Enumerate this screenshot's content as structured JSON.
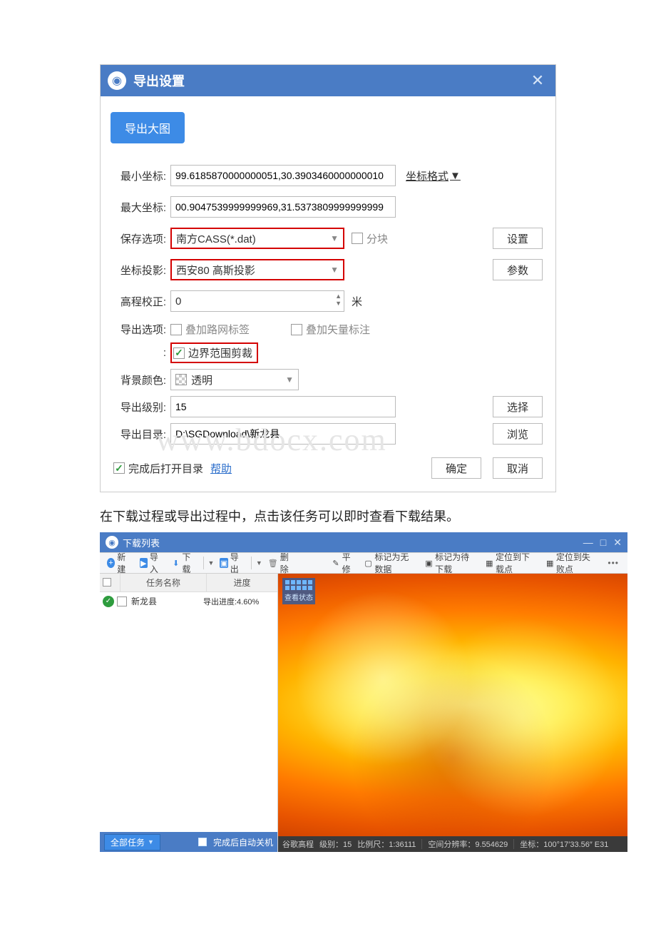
{
  "dialog": {
    "title": "导出设置",
    "tab": "导出大图",
    "labels": {
      "min_coord": "最小坐标",
      "max_coord": "最大坐标",
      "save_opt": "保存选项",
      "proj": "坐标投影",
      "elev": "高程校正",
      "export_opt": "导出选项",
      "bgcolor": "背景颜色",
      "level": "导出级别",
      "outdir": "导出目录"
    },
    "min_coord": "99.6185870000000051,30.3903460000000010",
    "max_coord": "00.9047539999999969,31.5373809999999999",
    "coord_format": "坐标格式",
    "save_option": "南方CASS(*.dat)",
    "split": "分块",
    "settings_btn": "设置",
    "projection": "西安80 高斯投影",
    "params_btn": "参数",
    "elev_value": "0",
    "elev_unit": "米",
    "opt_road": "叠加路网标签",
    "opt_vector": "叠加矢量标注",
    "opt_clip": "边界范围剪裁",
    "bgcolor": "透明",
    "level": "15",
    "select_btn": "选择",
    "outdir": "D:\\SGDownload\\新龙县",
    "browse_btn": "浏览",
    "open_after": "完成后打开目录",
    "help": "帮助",
    "ok": "确定",
    "cancel": "取消"
  },
  "watermark": "www.bdocx.com",
  "description": "在下载过程或导出过程中，点击该任务可以即时查看下载结果。",
  "app2": {
    "title": "下载列表",
    "toolbar": {
      "new": "新建",
      "import": "导入",
      "download": "下载",
      "export": "导出",
      "delete": "删除",
      "repair": "平修",
      "mark_nodata": "标记为无数据",
      "mark_todl": "标记为待下载",
      "locate_dl": "定位到下载点",
      "locate_fail": "定位到失败点"
    },
    "list": {
      "col_task": "任务名称",
      "col_progress": "进度",
      "task_name": "新龙县",
      "task_progress": "导出进度:4.60%"
    },
    "view_state": "查看状态",
    "left_footer": {
      "all_tasks": "全部任务",
      "auto_shutdown": "完成后自动关机"
    },
    "statusbar": {
      "source": "谷歌高程",
      "level_lbl": "级别：",
      "level_val": "15",
      "scale_lbl": "比例尺：",
      "scale_val": "1:36111",
      "res_lbl": "空间分辨率：",
      "res_val": "9.554629",
      "coord_lbl": "坐标：",
      "coord_val": "100°17′33.56″ E31"
    }
  }
}
